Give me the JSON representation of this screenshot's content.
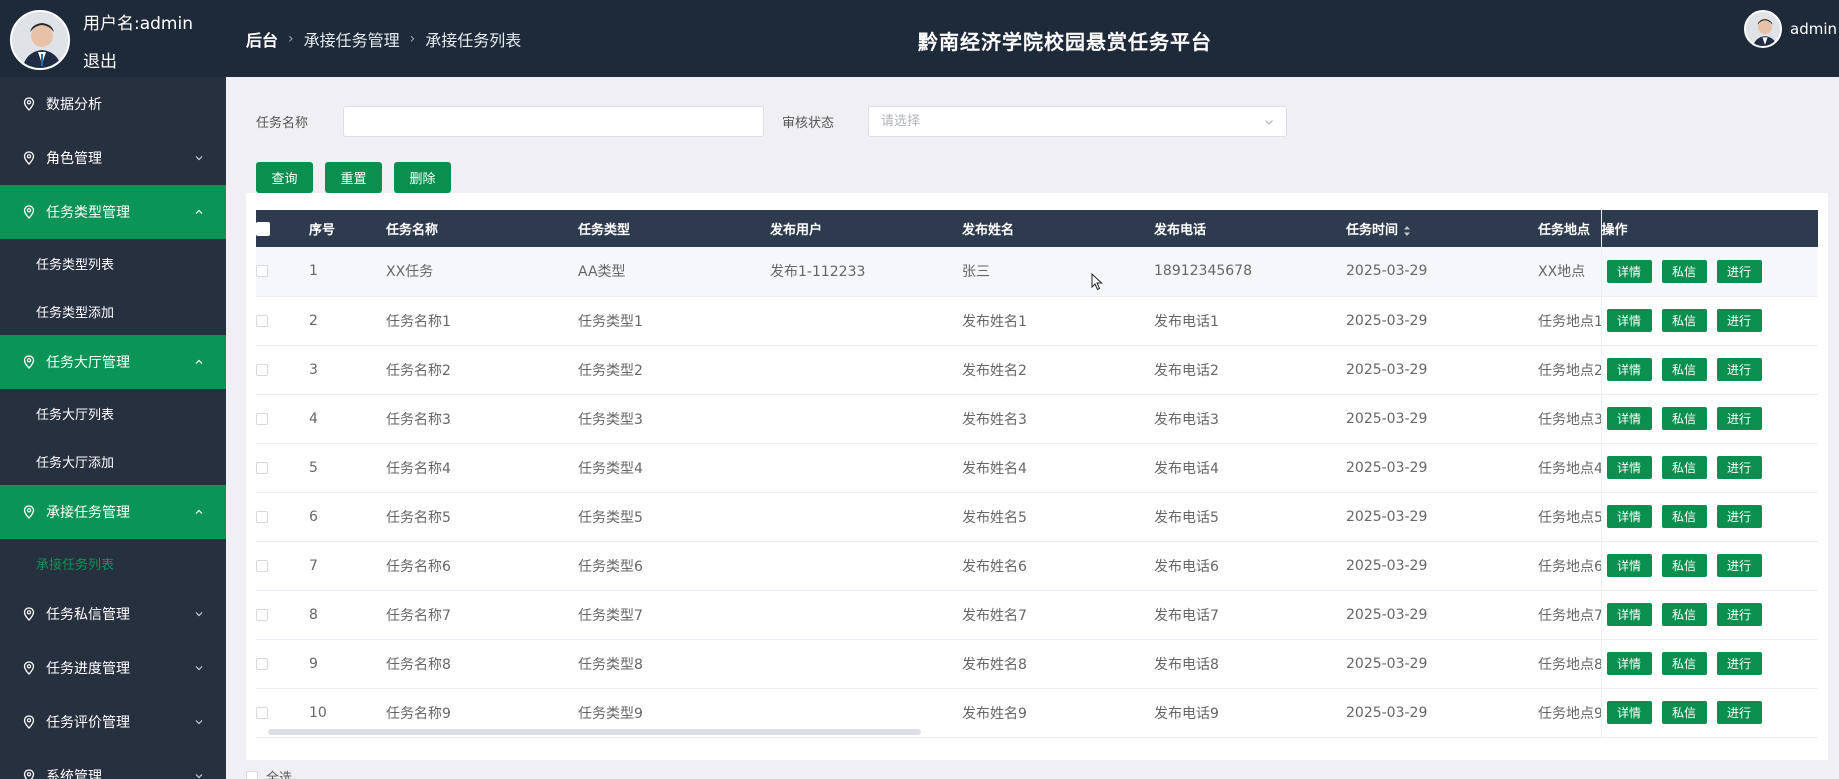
{
  "header": {
    "user_label": "用户名:admin",
    "logout": "退出",
    "breadcrumb": [
      "后台",
      "承接任务管理",
      "承接任务列表"
    ],
    "site_title": "黔南经济学院校园悬赏任务平台",
    "top_right_user": "admin"
  },
  "sidebar": {
    "items": [
      {
        "label": "数据分析",
        "expandable": false,
        "active": false
      },
      {
        "label": "角色管理",
        "expandable": true,
        "active": false
      },
      {
        "label": "任务类型管理",
        "expandable": true,
        "active": true,
        "children": [
          "任务类型列表",
          "任务类型添加"
        ]
      },
      {
        "label": "任务大厅管理",
        "expandable": true,
        "active": true,
        "children": [
          "任务大厅列表",
          "任务大厅添加"
        ]
      },
      {
        "label": "承接任务管理",
        "expandable": true,
        "active": true,
        "children": [
          "承接任务列表"
        ]
      },
      {
        "label": "任务私信管理",
        "expandable": true,
        "active": false
      },
      {
        "label": "任务进度管理",
        "expandable": true,
        "active": false
      },
      {
        "label": "任务评价管理",
        "expandable": true,
        "active": false
      },
      {
        "label": "系统管理",
        "expandable": true,
        "active": false
      }
    ]
  },
  "filters": {
    "task_name_label": "任务名称",
    "task_name_value": "",
    "audit_label": "审核状态",
    "audit_placeholder": "请选择"
  },
  "actions": {
    "query": "查询",
    "reset": "重置",
    "delete": "删除"
  },
  "table": {
    "headers": [
      "序号",
      "任务名称",
      "任务类型",
      "发布用户",
      "发布姓名",
      "发布电话",
      "任务时间",
      "任务地点",
      "操作"
    ],
    "row_buttons": [
      "详情",
      "私信",
      "进行"
    ],
    "rows": [
      [
        "1",
        "XX任务",
        "AA类型",
        "发布1-112233",
        "张三",
        "18912345678",
        "2025-03-29",
        "XX地点"
      ],
      [
        "2",
        "任务名称1",
        "任务类型1",
        "",
        "发布姓名1",
        "发布电话1",
        "2025-03-29",
        "任务地点1"
      ],
      [
        "3",
        "任务名称2",
        "任务类型2",
        "",
        "发布姓名2",
        "发布电话2",
        "2025-03-29",
        "任务地点2"
      ],
      [
        "4",
        "任务名称3",
        "任务类型3",
        "",
        "发布姓名3",
        "发布电话3",
        "2025-03-29",
        "任务地点3"
      ],
      [
        "5",
        "任务名称4",
        "任务类型4",
        "",
        "发布姓名4",
        "发布电话4",
        "2025-03-29",
        "任务地点4"
      ],
      [
        "6",
        "任务名称5",
        "任务类型5",
        "",
        "发布姓名5",
        "发布电话5",
        "2025-03-29",
        "任务地点5"
      ],
      [
        "7",
        "任务名称6",
        "任务类型6",
        "",
        "发布姓名6",
        "发布电话6",
        "2025-03-29",
        "任务地点6"
      ],
      [
        "8",
        "任务名称7",
        "任务类型7",
        "",
        "发布姓名7",
        "发布电话7",
        "2025-03-29",
        "任务地点7"
      ],
      [
        "9",
        "任务名称8",
        "任务类型8",
        "",
        "发布姓名8",
        "发布电话8",
        "2025-03-29",
        "任务地点8"
      ],
      [
        "10",
        "任务名称9",
        "任务类型9",
        "",
        "发布姓名9",
        "发布电话9",
        "2025-03-29",
        "任务地点9"
      ]
    ],
    "select_all": "全选"
  },
  "colors": {
    "header_bg": "#1e2a3a",
    "sidebar_bg": "#27303f",
    "accent_green": "#0a9455",
    "table_head_bg": "#2e3a4e"
  }
}
